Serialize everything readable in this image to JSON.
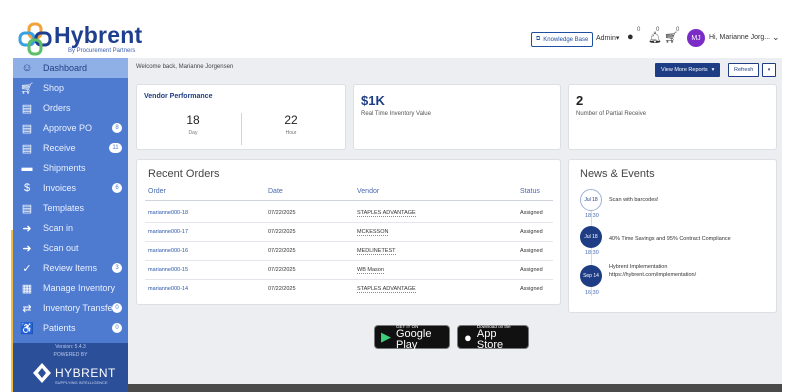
{
  "header": {
    "brand": "Hybrent",
    "tagline": "By Procurement Partners",
    "knowledge_base": "Knowledge Base",
    "admin": "Admin",
    "notif_counts": [
      "0",
      "0",
      "0"
    ],
    "avatar_initials": "MJ",
    "greeting": "Hi, Marianne Jorg..."
  },
  "sidebar": {
    "items": [
      {
        "label": "Dashboard",
        "icon": "dashboard-icon",
        "glyph": "☺"
      },
      {
        "label": "Shop",
        "icon": "cart-icon",
        "glyph": "🛒"
      },
      {
        "label": "Orders",
        "icon": "orders-icon",
        "glyph": "▤"
      },
      {
        "label": "Approve PO",
        "icon": "approve-icon",
        "glyph": "▤",
        "badge": "8"
      },
      {
        "label": "Receive",
        "icon": "receive-icon",
        "glyph": "▤",
        "badge": "11"
      },
      {
        "label": "Shipments",
        "icon": "truck-icon",
        "glyph": "▬"
      },
      {
        "label": "Invoices",
        "icon": "invoice-icon",
        "glyph": "$"
      },
      {
        "label": "Templates",
        "icon": "templates-icon",
        "glyph": "▤"
      },
      {
        "label": "Scan in",
        "icon": "scan-in-icon",
        "glyph": "➜"
      },
      {
        "label": "Scan out",
        "icon": "scan-out-icon",
        "glyph": "➜"
      },
      {
        "label": "Review Items",
        "icon": "check-icon",
        "glyph": "✓",
        "badge": "3"
      },
      {
        "label": "Manage Inventory",
        "icon": "inventory-icon",
        "glyph": "▦"
      },
      {
        "label": "Inventory Transfer",
        "icon": "transfer-icon",
        "glyph": "⇄",
        "badge": "0"
      },
      {
        "label": "Patients",
        "icon": "patient-icon",
        "glyph": "♿",
        "badge": "0"
      }
    ],
    "version": "Version: 5.4.3",
    "powered_by": "POWERED BY",
    "footer_brand": "HYBRENT",
    "footer_sub": "SUPPLYING INTELLIGENCE"
  },
  "main": {
    "welcome": "Welcome back, Marianne Jorgensen",
    "view_more_reports": "View More Reports",
    "refresh": "Refresh"
  },
  "vendor_performance": {
    "title": "Vendor Performance",
    "day_value": "18",
    "day_label": "Day",
    "hour_value": "22",
    "hour_label": "Hour"
  },
  "inventory_value": {
    "value": "$1K",
    "label": "Real Time Inventory Value"
  },
  "partial_receive": {
    "value": "2",
    "label": "Number of Partial Receive"
  },
  "recent_orders": {
    "title": "Recent Orders",
    "columns": [
      "Order",
      "Date",
      "Vendor",
      "Status"
    ],
    "rows": [
      [
        "marianne000-18",
        "07/22/2025",
        "STAPLES ADVANTAGE",
        "Assigned"
      ],
      [
        "marianne000-17",
        "07/22/2025",
        "MCKESSON",
        "Assigned"
      ],
      [
        "marianne000-16",
        "07/22/2025",
        "MEDLINETEST",
        "Assigned"
      ],
      [
        "marianne000-15",
        "07/22/2025",
        "WB Mason",
        "Assigned"
      ],
      [
        "marianne000-14",
        "07/22/2025",
        "STAPLES ADVANTAGE",
        "Assigned"
      ]
    ]
  },
  "news": {
    "title": "News & Events",
    "events": [
      {
        "date": "Jul 18",
        "time": "18:30",
        "text": "Scan with barcodes!",
        "style": "outline"
      },
      {
        "date": "Jul 18",
        "time": "18:30",
        "text": "40% Time Savings and 95% Contract Compliance",
        "style": "filled"
      },
      {
        "date": "Sep 14",
        "time": "16:30",
        "text": "Hybrent Implementation",
        "text2": "https://hybrent.com/implementation/",
        "style": "filled"
      }
    ]
  },
  "stores": {
    "google_small": "GET IT ON",
    "google_big": "Google Play",
    "apple_small": "Download on the",
    "apple_big": "App Store"
  },
  "colors": {
    "brand": "#1f3d85",
    "sidebar": "#4e7bd0",
    "sidebar_active": "#8fb0e6",
    "avatar": "#7b2cc7"
  }
}
